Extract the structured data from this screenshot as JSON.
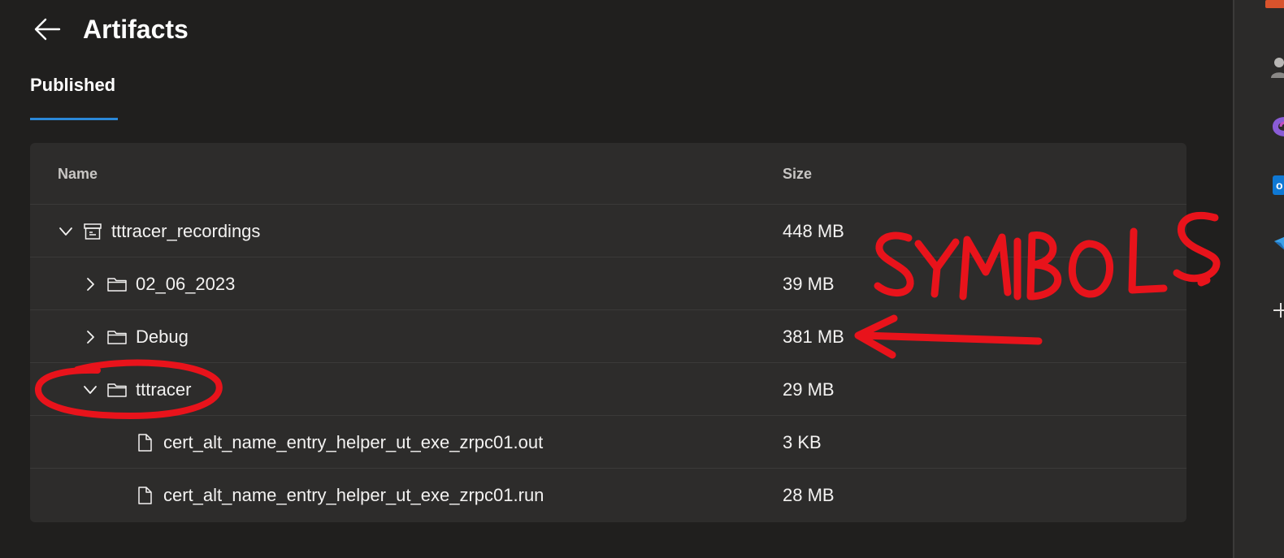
{
  "header": {
    "title": "Artifacts"
  },
  "tabs": [
    {
      "label": "Published",
      "selected": true
    }
  ],
  "table": {
    "columns": {
      "name": "Name",
      "size": "Size"
    },
    "rows": [
      {
        "name": "tttracer_recordings",
        "size": "448 MB",
        "type": "artifact",
        "expanded": true,
        "depth": 0
      },
      {
        "name": "02_06_2023",
        "size": "39 MB",
        "type": "folder",
        "expanded": false,
        "depth": 1
      },
      {
        "name": "Debug",
        "size": "381 MB",
        "type": "folder",
        "expanded": false,
        "depth": 1
      },
      {
        "name": "tttracer",
        "size": "29 MB",
        "type": "folder",
        "expanded": true,
        "depth": 1
      },
      {
        "name": "cert_alt_name_entry_helper_ut_exe_zrpc01.out",
        "size": "3 KB",
        "type": "file",
        "depth": 2
      },
      {
        "name": "cert_alt_name_entry_helper_ut_exe_zrpc01.run",
        "size": "28 MB",
        "type": "file",
        "depth": 2
      }
    ]
  },
  "annotation": {
    "handwritten_text": "SYMBOLS",
    "ink_color": "#e8131b"
  },
  "colors": {
    "background": "#201f1e",
    "card": "#2d2c2b",
    "accent": "#2b88d8"
  }
}
